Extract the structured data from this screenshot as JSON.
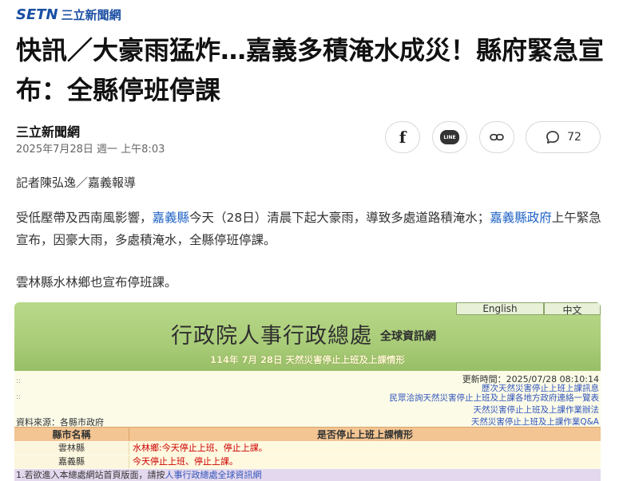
{
  "brand": {
    "logo_main": "SETN",
    "logo_sub": "三立新聞網"
  },
  "article": {
    "headline": "快訊／大豪雨猛炸…嘉義多積淹水成災！縣府緊急宣布：全縣停班停課",
    "source": "三立新聞網",
    "date": "2025年7月28日 週一 上午8:03",
    "byline": "記者陳弘逸／嘉義報導",
    "para1": {
      "t1": "受低壓帶及西南風影響，",
      "link1": "嘉義縣",
      "t2": "今天（28日）清晨下起大豪雨，導致多處道路積淹水；",
      "link2": "嘉義縣政府",
      "t3": "上午緊急宣布，因豪大雨，多處積淹水，全縣停班停課。"
    },
    "para2": "雲林縣水林鄉也宣布停班課。"
  },
  "share": {
    "facebook_icon": "f",
    "line_icon": "LINE",
    "comment_count": "72"
  },
  "embedded": {
    "lang_en": "English",
    "lang_zh": "中文",
    "title": "行政院人事行政總處",
    "subtitle": "全球資訊網",
    "date_line": "114年 7月 28日 天然災害停止上班及上課情形",
    "updated": "更新時間：2025/07/28 08:10:14",
    "links": [
      "歷次天然災害停止上班上課訊息",
      "民眾洽詢天然災害停止上班及上課各地方政府連絡一覽表",
      "天然災害停止上班及上課作業辦法",
      "天然災害停止上班及上課作業Q&A"
    ],
    "data_source": "資料來源：各縣市政府",
    "table": {
      "headers": [
        "縣市名稱",
        "是否停止上班上課情形"
      ],
      "rows": [
        {
          "county": "雲林縣",
          "status": "水林鄉:今天停止上班、停止上課。"
        },
        {
          "county": "嘉義縣",
          "status": "今天停止上班、停止上課。"
        }
      ]
    },
    "footer_text": "1.若欲進入本總處網站首頁版面，請按",
    "footer_link": "人事行政總處全球資訊網"
  }
}
